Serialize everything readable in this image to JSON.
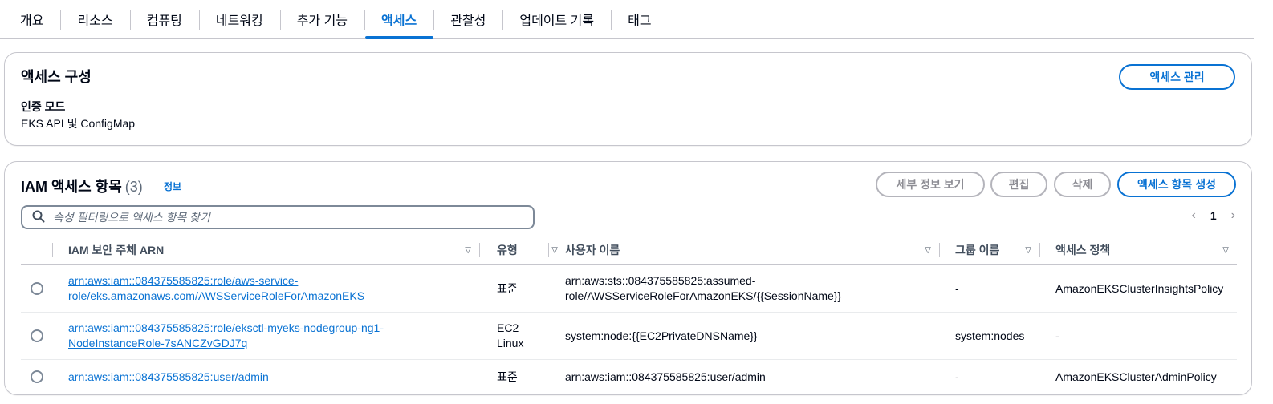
{
  "tabs": [
    {
      "label": "개요"
    },
    {
      "label": "리소스"
    },
    {
      "label": "컴퓨팅"
    },
    {
      "label": "네트워킹"
    },
    {
      "label": "추가 기능"
    },
    {
      "label": "액세스",
      "active": true
    },
    {
      "label": "관찰성"
    },
    {
      "label": "업데이트 기록"
    },
    {
      "label": "태그"
    }
  ],
  "access_config": {
    "title": "액세스 구성",
    "manage_button": "액세스 관리",
    "auth_mode_label": "인증 모드",
    "auth_mode_value": "EKS API 및 ConfigMap"
  },
  "iam_entries": {
    "title": "IAM 액세스 항목",
    "count": "(3)",
    "info_link": "정보",
    "buttons": {
      "details": "세부 정보 보기",
      "edit": "편집",
      "delete": "삭제",
      "create": "액세스 항목 생성"
    },
    "search_placeholder": "속성 필터링으로 액세스 항목 찾기",
    "pagination": {
      "current_page": "1"
    },
    "columns": [
      "IAM 보안 주체 ARN",
      "유형",
      "사용자 이름",
      "그룹 이름",
      "액세스 정책"
    ],
    "rows": [
      {
        "arn_line1": "arn:aws:iam::084375585825:role/aws-service-",
        "arn_line2": "role/eks.amazonaws.com/AWSServiceRoleForAmazonEKS",
        "type_line1": "표준",
        "type_line2": "",
        "username_line1": "arn:aws:sts::084375585825:assumed-",
        "username_line2": "role/AWSServiceRoleForAmazonEKS/{{SessionName}}",
        "group": "-",
        "policy": "AmazonEKSClusterInsightsPolicy"
      },
      {
        "arn_line1": "arn:aws:iam::084375585825:role/eksctl-myeks-nodegroup-ng1-",
        "arn_line2": "NodeInstanceRole-7sANCZvGDJ7q",
        "type_line1": "EC2",
        "type_line2": "Linux",
        "username_line1": "system:node:{{EC2PrivateDNSName}}",
        "username_line2": "",
        "group": "system:nodes",
        "policy": "-"
      },
      {
        "arn_line1": "arn:aws:iam::084375585825:user/admin",
        "arn_line2": "",
        "type_line1": "표준",
        "type_line2": "",
        "username_line1": "arn:aws:iam::084375585825:user/admin",
        "username_line2": "",
        "group": "-",
        "policy": "AmazonEKSClusterAdminPolicy"
      }
    ]
  },
  "colors": {
    "accent": "#0972d3",
    "border": "#c6c6cd",
    "text": "#000716"
  }
}
